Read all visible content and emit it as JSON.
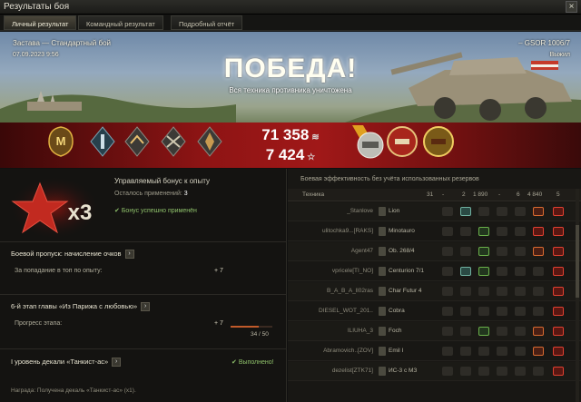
{
  "window": {
    "title": "Результаты боя",
    "close_label": "×"
  },
  "tabs": [
    {
      "label": "Личный результат",
      "active": true
    },
    {
      "label": "Командный результат",
      "active": false
    },
    {
      "label": "Подробный отчёт",
      "active": false
    }
  ],
  "battle": {
    "map_mode": "Застава — Стандартный бой",
    "datetime": "07.09.2023  9:56",
    "vehicle": "– GSOR 1006/7",
    "status": "Выжил",
    "result": "ПОБЕДА!",
    "result_sub": "Вся техника противника уничтожена",
    "credits": "71 358",
    "xp": "7 424",
    "mastery_label": "M"
  },
  "bonus": {
    "multiplier": "x3",
    "title": "Управляемый бонус к опыту",
    "remaining_label": "Осталось применений:",
    "remaining_value": "3",
    "applied": "Бонус успешно применён"
  },
  "progress_sections": [
    {
      "heading": "Боевой пропуск: начисление очков",
      "row_label": "За попадание в топ по опыту:",
      "row_value": "+ 7"
    },
    {
      "heading": "6-й этап главы «Из Парижа с любовью»",
      "row_label": "Прогресс этапа:",
      "row_value": "+ 7",
      "progress_text": "34 / 50",
      "progress_fraction": 0.68
    },
    {
      "heading": "I уровень декали «Танкист-ас»",
      "status": "Выполнено!"
    }
  ],
  "reward_line": "Награда:   Получена декаль «Танкист-ас» (х1).",
  "efficiency": {
    "title": "Боевая эффективность без учёта использованных резервов",
    "columns": [
      "Техника",
      "31",
      "-",
      "2",
      "1 890",
      "-",
      "6",
      "4 840",
      "5"
    ],
    "rows": [
      {
        "player": "_Stanlove",
        "tank": "Lion",
        "cells": [
          "",
          "spot",
          "",
          "",
          "",
          "dmg",
          "kill"
        ]
      },
      {
        "player": "ulitochka9...[RAKS]",
        "tank": "Minotauro",
        "cells": [
          "",
          "",
          "ass",
          "",
          "",
          "kill",
          "kill"
        ]
      },
      {
        "player": "Agent47",
        "tank": "Ob. 268/4",
        "cells": [
          "",
          "",
          "ass",
          "",
          "",
          "dmg",
          "kill"
        ]
      },
      {
        "player": "vpricele[TI_NO]",
        "tank": "Centurion 7/1",
        "cells": [
          "",
          "spot",
          "ass",
          "",
          "",
          "",
          "kill"
        ]
      },
      {
        "player": "B_A_B_A_ll02ras",
        "tank": "Char Futur 4",
        "cells": [
          "",
          "",
          "",
          "",
          "",
          "",
          "kill"
        ]
      },
      {
        "player": "DIESEL_WOT_201..",
        "tank": "Cobra",
        "cells": [
          "",
          "",
          "",
          "",
          "",
          "",
          "kill"
        ]
      },
      {
        "player": "ILIUHA_3",
        "tank": "Foch",
        "cells": [
          "",
          "",
          "ass",
          "",
          "",
          "dmg",
          "kill"
        ]
      },
      {
        "player": "Abramovich..[ZOV]",
        "tank": "Emil I",
        "cells": [
          "",
          "",
          "",
          "",
          "",
          "dmg",
          "kill"
        ]
      },
      {
        "player": "dezelist[ZTK71]",
        "tank": "ИС-3 с МЗ",
        "cells": [
          "",
          "",
          "",
          "",
          "",
          "",
          "kill"
        ]
      }
    ]
  },
  "colors": {
    "accent": "#d86a30",
    "victory_band": "#a01818",
    "ok_green": "#8ec06a"
  }
}
